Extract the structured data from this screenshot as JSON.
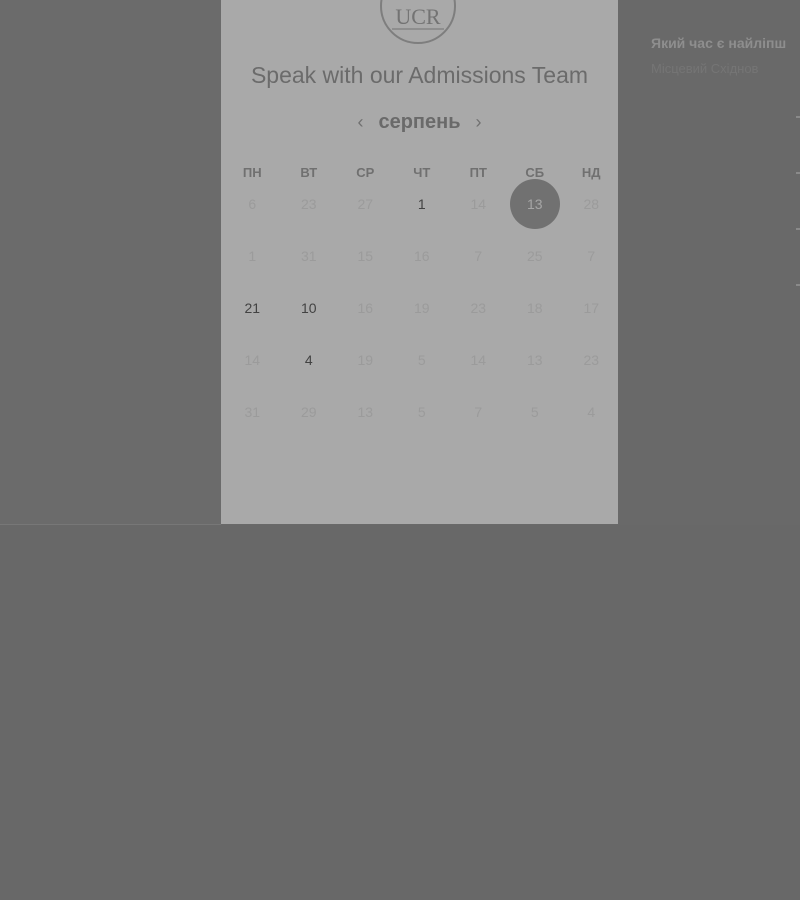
{
  "header": {
    "logo_text": "UCR",
    "title": "Speak with our Admissions Team"
  },
  "calendar": {
    "month": "серпень",
    "prev_icon": "chevron-left-icon",
    "next_icon": "chevron-right-icon",
    "weekdays": [
      "ПН",
      "ВТ",
      "СР",
      "ЧТ",
      "ПТ",
      "СБ",
      "НД"
    ],
    "weeks": [
      [
        {
          "label": "6",
          "active": false
        },
        {
          "label": "23",
          "active": false
        },
        {
          "label": "27",
          "active": false
        },
        {
          "label": "1",
          "active": true
        },
        {
          "label": "14",
          "active": false
        },
        {
          "label": "13",
          "active": true,
          "selected": true
        },
        {
          "label": "28",
          "active": false
        }
      ],
      [
        {
          "label": "1",
          "active": false
        },
        {
          "label": "31",
          "active": false
        },
        {
          "label": "15",
          "active": false
        },
        {
          "label": "16",
          "active": false
        },
        {
          "label": "7",
          "active": false
        },
        {
          "label": "25",
          "active": false
        },
        {
          "label": "7",
          "active": false
        }
      ],
      [
        {
          "label": "21",
          "active": true
        },
        {
          "label": "10",
          "active": true
        },
        {
          "label": "16",
          "active": false
        },
        {
          "label": "19",
          "active": false
        },
        {
          "label": "23",
          "active": false
        },
        {
          "label": "18",
          "active": false
        },
        {
          "label": "17",
          "active": false
        }
      ],
      [
        {
          "label": "14",
          "active": false
        },
        {
          "label": "4",
          "active": true
        },
        {
          "label": "19",
          "active": false
        },
        {
          "label": "5",
          "active": false
        },
        {
          "label": "14",
          "active": false
        },
        {
          "label": "13",
          "active": false
        },
        {
          "label": "23",
          "active": false
        }
      ],
      [
        {
          "label": "31",
          "active": false
        },
        {
          "label": "29",
          "active": false
        },
        {
          "label": "13",
          "active": false
        },
        {
          "label": "5",
          "active": false
        },
        {
          "label": "7",
          "active": false
        },
        {
          "label": "5",
          "active": false
        },
        {
          "label": "4",
          "active": false
        }
      ]
    ]
  },
  "side": {
    "question": "Який час є найліпш",
    "timezone": "Місцевий Східнов"
  },
  "colors": {
    "card_background": "#a9a9a9",
    "overlay": "#696969",
    "selected_day": "#717171"
  }
}
